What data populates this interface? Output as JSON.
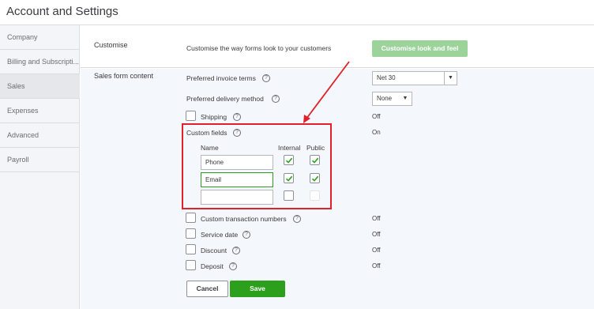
{
  "header": {
    "title": "Account and Settings"
  },
  "sidebar": {
    "items": [
      {
        "label": "Company"
      },
      {
        "label": "Billing and Subscripti..."
      },
      {
        "label": "Sales"
      },
      {
        "label": "Expenses"
      },
      {
        "label": "Advanced"
      },
      {
        "label": "Payroll"
      }
    ],
    "active": "Sales"
  },
  "customise": {
    "label": "Customise",
    "description": "Customise the way forms look to your customers",
    "button": "Customise look and feel"
  },
  "sales_form": {
    "label": "Sales form content",
    "invoice_terms": {
      "label": "Preferred invoice terms",
      "value": "Net 30"
    },
    "delivery_method": {
      "label": "Preferred delivery method",
      "value": "None"
    },
    "shipping": {
      "label": "Shipping",
      "checked": false,
      "status": "Off"
    },
    "custom_fields": {
      "label": "Custom fields",
      "status": "On",
      "col_name": "Name",
      "col_internal": "Internal",
      "col_public": "Public",
      "rows": [
        {
          "name": "Phone",
          "internal": true,
          "public": true
        },
        {
          "name": "Email",
          "internal": true,
          "public": true
        },
        {
          "name": "",
          "internal": false,
          "public": false
        }
      ]
    },
    "custom_txn_numbers": {
      "label": "Custom transaction numbers",
      "checked": false,
      "status": "Off"
    },
    "service_date": {
      "label": "Service date",
      "checked": false,
      "status": "Off"
    },
    "discount": {
      "label": "Discount",
      "checked": false,
      "status": "Off"
    },
    "deposit": {
      "label": "Deposit",
      "checked": false,
      "status": "Off"
    }
  },
  "actions": {
    "cancel": "Cancel",
    "save": "Save"
  },
  "colors": {
    "accent": "#2ca01c",
    "annotation": "#e0202a",
    "disabled_button": "#9bd39b"
  }
}
